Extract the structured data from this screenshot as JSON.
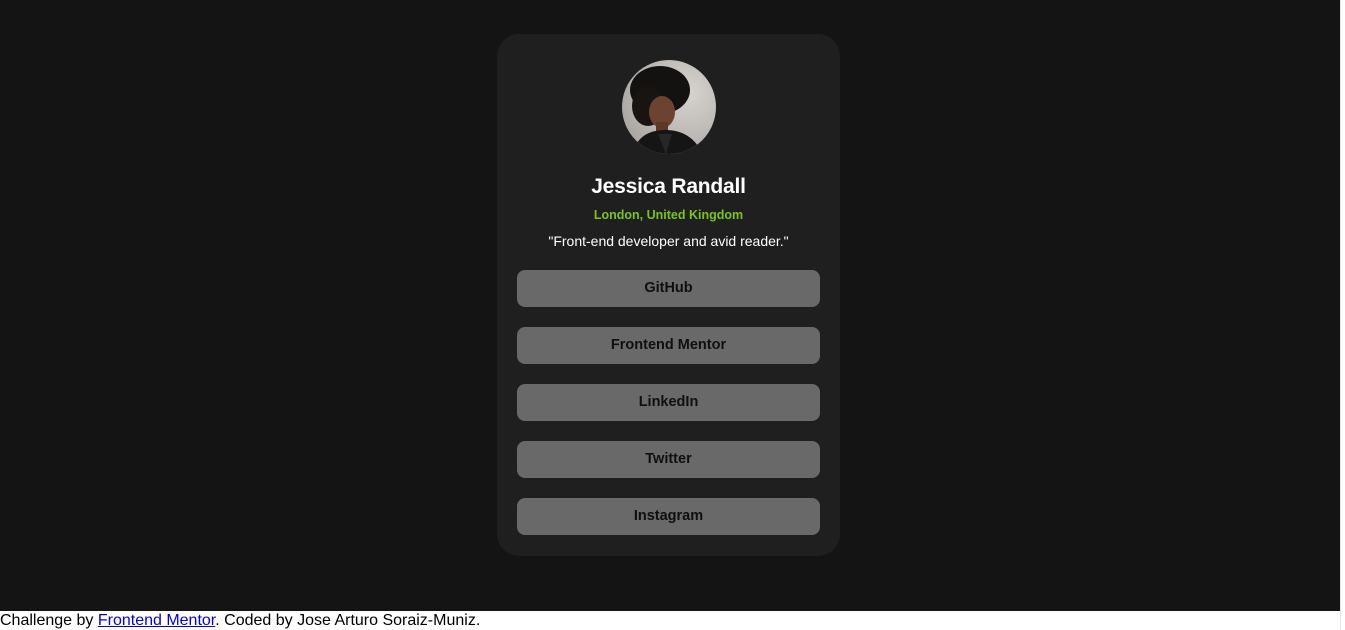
{
  "profile": {
    "name": "Jessica Randall",
    "location": "London, United Kingdom",
    "bio": "\"Front-end developer and avid reader.\""
  },
  "links": [
    {
      "label": "GitHub"
    },
    {
      "label": "Frontend Mentor"
    },
    {
      "label": "LinkedIn"
    },
    {
      "label": "Twitter"
    },
    {
      "label": "Instagram"
    }
  ],
  "footer": {
    "prefix": "Challenge by ",
    "link_text": "Frontend Mentor",
    "suffix": ". Coded by Jose Arturo Soraiz-Muniz."
  },
  "colors": {
    "background": "#141414",
    "card": "#1f1f1f",
    "accent": "#7ac41c",
    "button": "#696969"
  }
}
